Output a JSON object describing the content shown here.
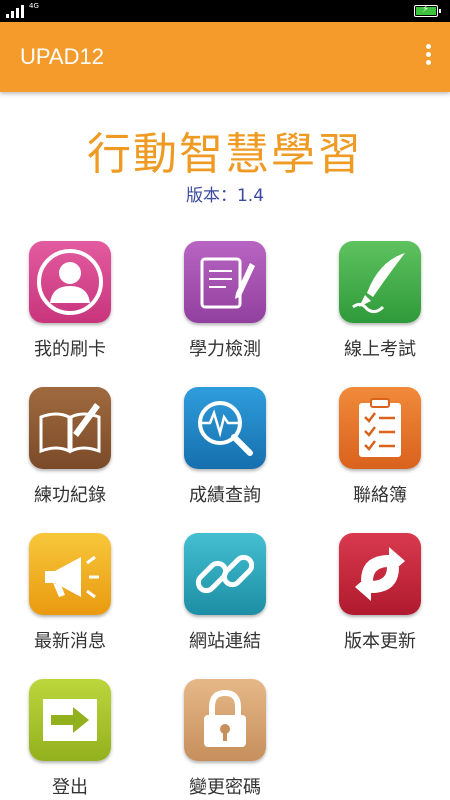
{
  "statusbar": {
    "network": "4G",
    "battery_color": "#3cc23c"
  },
  "appbar": {
    "title": "UPAD12",
    "menu_icon": "more-vert-icon",
    "color": "#f49b2c"
  },
  "header": {
    "title": "行動智慧學習",
    "version": "版本：1.4",
    "title_color": "#ef9a22",
    "version_color": "#3b4aa0"
  },
  "menu": [
    {
      "label": "我的刷卡",
      "icon": "user-card-icon",
      "color": "#d8488f"
    },
    {
      "label": "學力檢測",
      "icon": "notebook-pen-icon",
      "color": "#a44fb0"
    },
    {
      "label": "線上考試",
      "icon": "quill-pen-icon",
      "color": "#46b04a"
    },
    {
      "label": "練功紀錄",
      "icon": "open-book-icon",
      "color": "#8c5a34"
    },
    {
      "label": "成績查詢",
      "icon": "magnifier-chart-icon",
      "color": "#1f86c8"
    },
    {
      "label": "聯絡簿",
      "icon": "clipboard-icon",
      "color": "#ea7a2a"
    },
    {
      "label": "最新消息",
      "icon": "megaphone-icon",
      "color": "#f3b21c"
    },
    {
      "label": "網站連結",
      "icon": "chain-link-icon",
      "color": "#2aa7bd"
    },
    {
      "label": "版本更新",
      "icon": "refresh-arrows-icon",
      "color": "#c9233a"
    },
    {
      "label": "登出",
      "icon": "logout-arrow-icon",
      "color": "#a8c52a"
    },
    {
      "label": "變更密碼",
      "icon": "padlock-icon",
      "color": "#d9a572"
    }
  ]
}
